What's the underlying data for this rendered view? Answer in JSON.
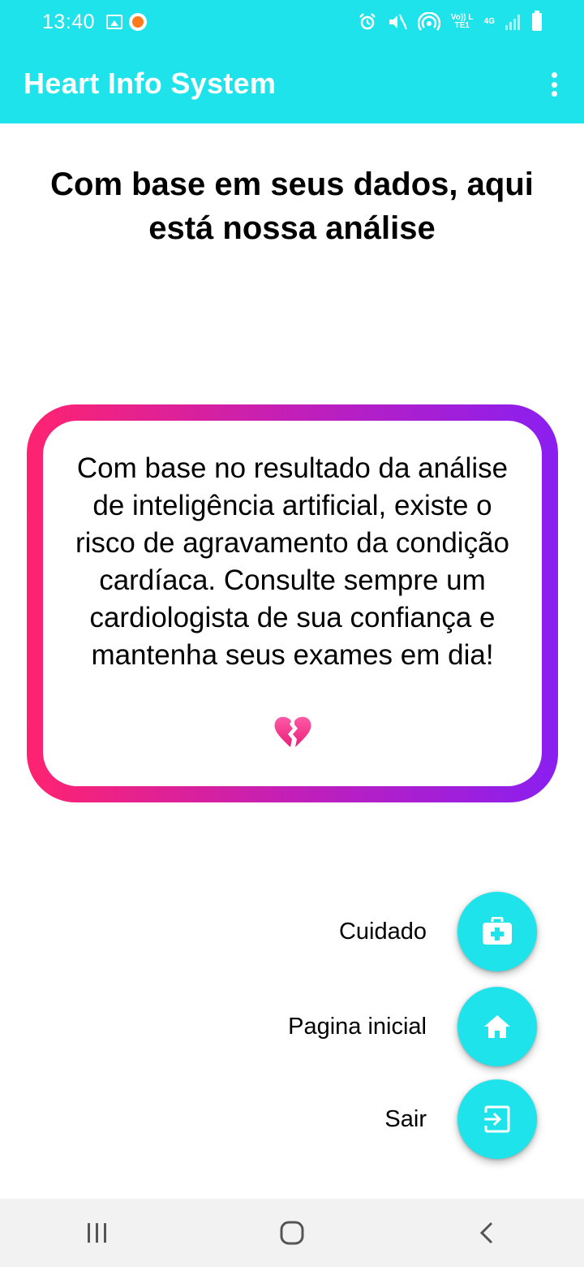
{
  "status_bar": {
    "time": "13:40",
    "network_volte": "Vo)) LTE1",
    "network_type": "4G",
    "icons": [
      "image-icon",
      "notification-app-icon",
      "alarm-icon",
      "mute-icon",
      "hotspot-icon",
      "signal-icon",
      "battery-icon"
    ]
  },
  "app_bar": {
    "title": "Heart Info System",
    "menu_icon": "overflow-menu-icon"
  },
  "headline": "Com base em seus dados, aqui está nossa análise",
  "result_card": {
    "message": "Com base no resultado da análise de inteligência artificial, existe o risco de agravamento da condição cardíaca. Consulte sempre um cardiologista de sua confiança e mantenha seus exames em dia!",
    "emoji_icon": "broken-heart-icon",
    "gradient_colors": [
      "#ff2370",
      "#c21fb8",
      "#8a1ff0"
    ]
  },
  "actions": {
    "care_label": "Cuidado",
    "home_label": "Pagina inicial",
    "exit_label": "Sair"
  },
  "nav_bar": {
    "buttons": [
      "recent-apps-icon",
      "home-icon",
      "back-icon"
    ]
  },
  "colors": {
    "primary": "#1fe3ea",
    "fab": "#1fe3ea",
    "nav_background": "#f2f2f2"
  }
}
